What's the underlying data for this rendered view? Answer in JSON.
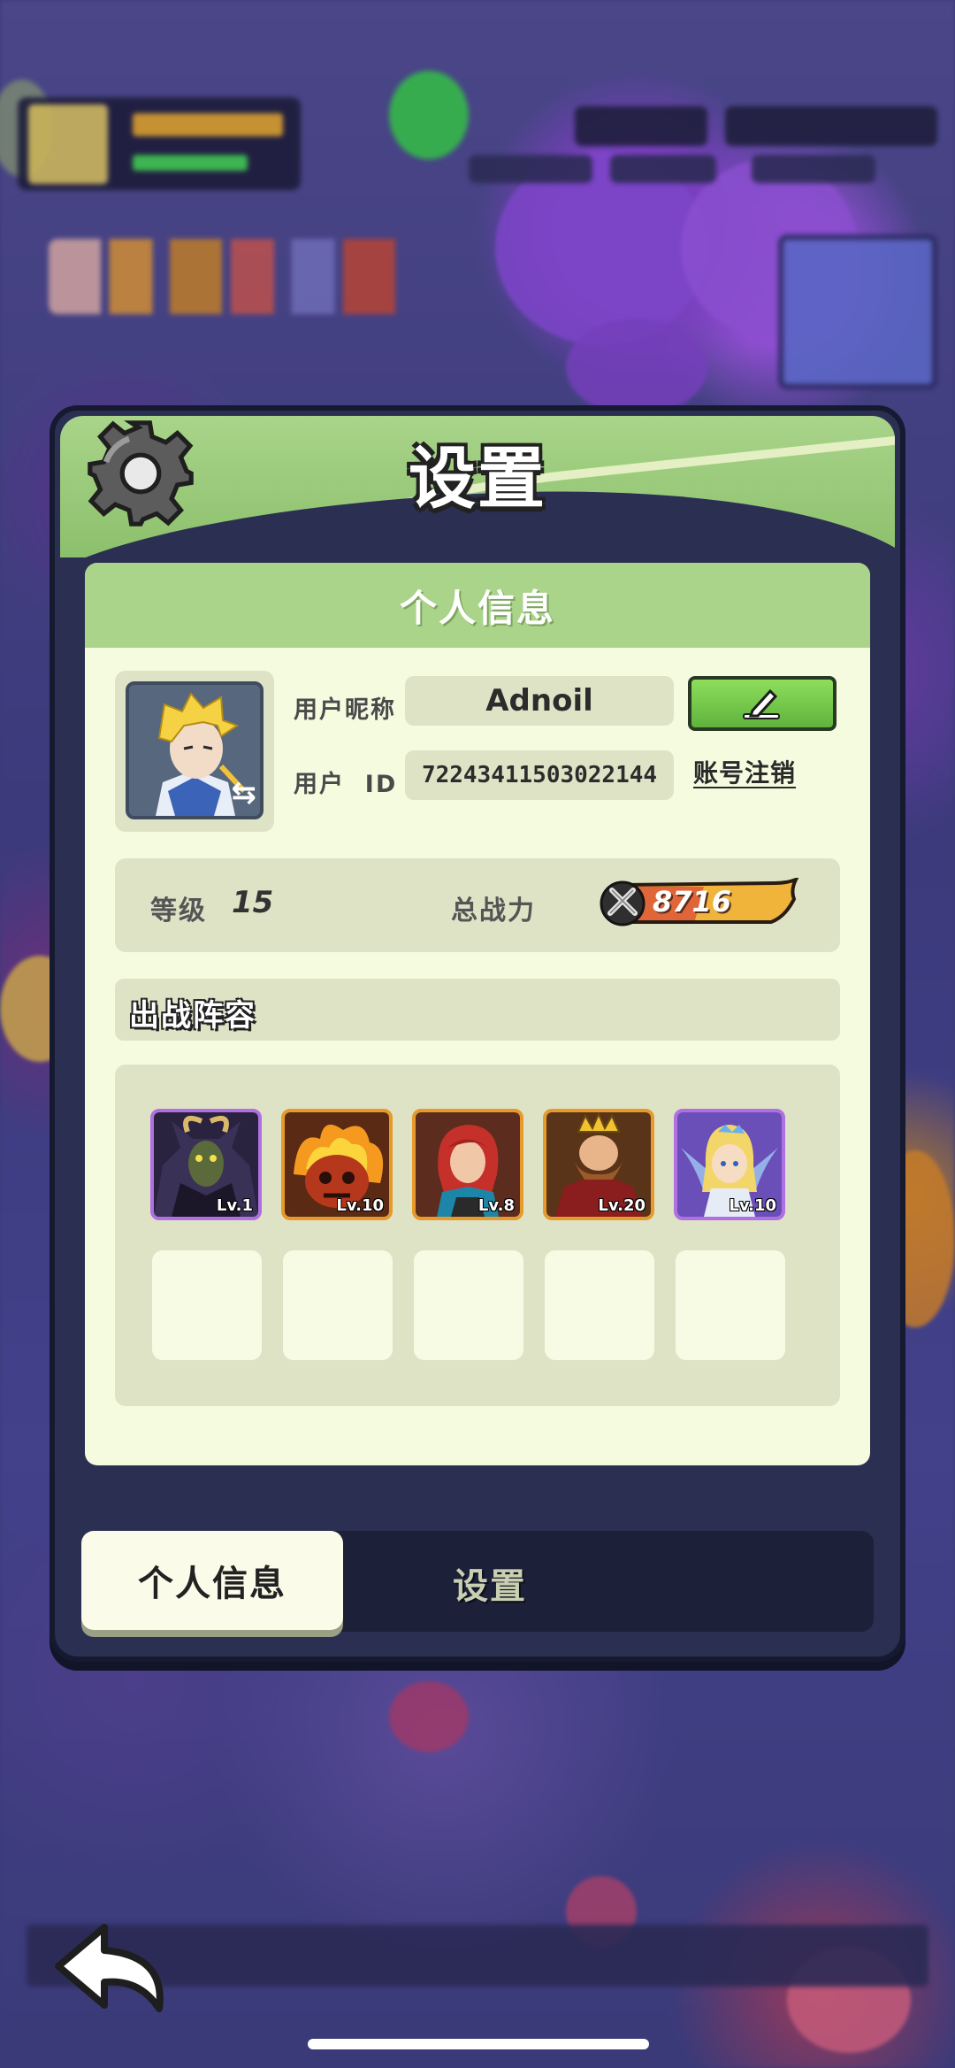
{
  "panel": {
    "title": "设置"
  },
  "profile": {
    "section_title": "个人信息",
    "nickname_label": "用户昵称",
    "nickname_value": "Adnoil",
    "id_label": "用户  ID",
    "id_value": "72243411503022144",
    "cancel_account_label": "账号注销",
    "level_label": "等级",
    "level_value": "15",
    "power_label": "总战力",
    "power_value": "8716"
  },
  "lineup": {
    "title": "出战阵容",
    "heroes": [
      {
        "level": "Lv.1",
        "rarity": "purple",
        "icon": "goat-demon-hero-icon"
      },
      {
        "level": "Lv.10",
        "rarity": "orange",
        "icon": "fire-golem-hero-icon"
      },
      {
        "level": "Lv.8",
        "rarity": "orange",
        "icon": "red-hair-girl-hero-icon"
      },
      {
        "level": "Lv.20",
        "rarity": "orange",
        "icon": "dwarf-king-hero-icon"
      },
      {
        "level": "Lv.10",
        "rarity": "purple",
        "icon": "fairy-hero-icon"
      }
    ],
    "empty_slots": 5
  },
  "tabs": {
    "active": "个人信息",
    "inactive": "设置"
  },
  "colors": {
    "header_green": "#a9d48a",
    "card_bg": "#f5fbdf",
    "panel_dark": "#2b2f52",
    "purple_rarity": "#b06fe2",
    "orange_rarity": "#e79a2b",
    "edit_green": "#6fc44a"
  }
}
